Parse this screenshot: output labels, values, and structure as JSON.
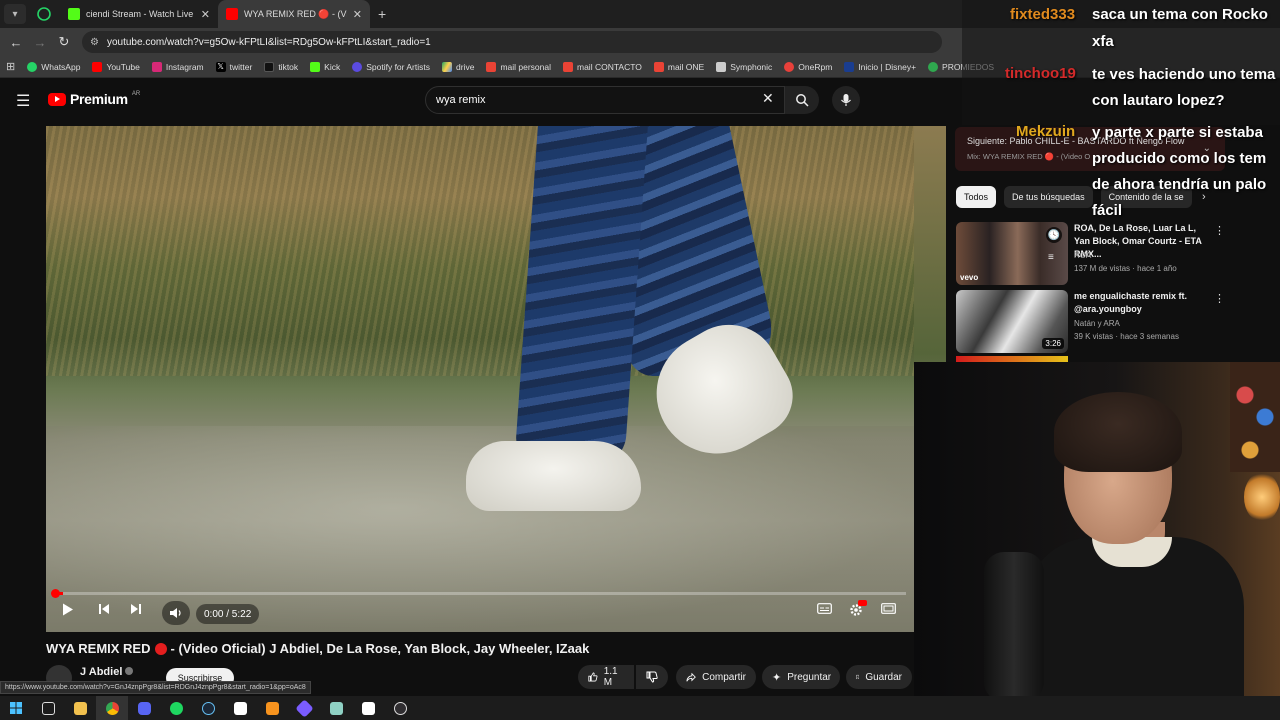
{
  "tabs": [
    {
      "title": "ciendi Stream - Watch Live on K",
      "favicon_color": "#53fc18"
    },
    {
      "title": "WYA REMIX RED 🔴 - (Video O",
      "favicon_color": "#ff0000"
    }
  ],
  "address": {
    "url": "youtube.com/watch?v=g5Ow-kFPtLI&list=RDg5Ow-kFPtLI&start_radio=1"
  },
  "bookmarks": [
    {
      "label": "WhatsApp",
      "color": "#25d366"
    },
    {
      "label": "YouTube",
      "color": "#ff0000"
    },
    {
      "label": "Instagram",
      "color": "#d62976"
    },
    {
      "label": "twitter",
      "color": "#ffffff"
    },
    {
      "label": "tiktok",
      "color": "#ffffff"
    },
    {
      "label": "Kick",
      "color": "#53fc18"
    },
    {
      "label": "Spotify for Artists",
      "color": "#5b4be0"
    },
    {
      "label": "drive",
      "color": "#1fa463"
    },
    {
      "label": "mail personal",
      "color": "#ea4335"
    },
    {
      "label": "mail CONTACTO",
      "color": "#ea4335"
    },
    {
      "label": "mail ONE",
      "color": "#ea4335"
    },
    {
      "label": "Symphonic",
      "color": "#cccccc"
    },
    {
      "label": "OneRpm",
      "color": "#e8403a"
    },
    {
      "label": "Inicio | Disney+",
      "color": "#1a3d8f"
    },
    {
      "label": "PROMIEDOS",
      "color": "#2fa84f"
    }
  ],
  "youtube": {
    "logo_text": "Premium",
    "country": "AR",
    "search_value": "wya remix"
  },
  "player": {
    "time": "0:00 / 5:22",
    "progress": 0.01
  },
  "video": {
    "title_part1": "WYA REMIX RED",
    "title_part2": "- (Video Oficial) J Abdiel, De La Rose, Yan Block, Jay Wheeler, IZaak",
    "channel": "J Abdiel",
    "subscribe": "Suscribirse",
    "likes": "1.1 M",
    "share": "Compartir",
    "ask": "Preguntar",
    "save": "Guardar"
  },
  "status_url": "https://www.youtube.com/watch?v=GnJ4znpPgr8&list=RDGnJ4znpPgr8&start_radio=1&pp=oAc8",
  "sidebar": {
    "next_label": "Siguiente: Pablo CHILL-E - BASTARDO ft Ñengo Flow",
    "mix_label": "Mix: WYA REMIX RED 🔴 - (Video O",
    "chips": [
      "Todos",
      "De tus búsquedas",
      "Contenido de la se"
    ],
    "recs": [
      {
        "title": "ROA, De La Rose, Luar La L, Yan Block, Omar Courtz - ETA RMX...",
        "channel": "ROA",
        "meta": "137 M de vistas · hace 1 año",
        "badge": "vevo",
        "duration": ""
      },
      {
        "title": "me engualichaste remix ft. @ara.youngboy",
        "channel": "Natán y ARA",
        "meta": "39 K vistas · hace 3 semanas",
        "badge": "",
        "duration": "3:26"
      }
    ]
  },
  "chat": [
    {
      "user": "fixted333",
      "msg": "saca un tema con Rocko"
    },
    {
      "user": "",
      "msg": "xfa"
    },
    {
      "user": "tinchoo19",
      "msg": "te ves haciendo uno tema"
    },
    {
      "user": "",
      "msg": "con lautaro lopez?"
    },
    {
      "user": "Mekzuin",
      "msg": "y parte x parte si estaba"
    },
    {
      "user": "",
      "msg": "producido como los tem"
    },
    {
      "user": "",
      "msg": "de ahora tendría un palo"
    },
    {
      "user": "",
      "msg": "fácil"
    }
  ]
}
